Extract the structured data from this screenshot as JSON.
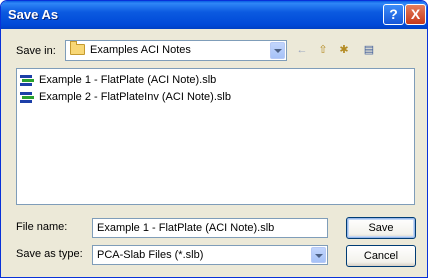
{
  "window": {
    "title": "Save As"
  },
  "title_buttons": {
    "help": "?",
    "close": "X"
  },
  "save_in": {
    "label": "Save in:",
    "value": "Examples ACI Notes"
  },
  "toolbar": {
    "back": "←",
    "up": "⇧",
    "new_folder": "✱",
    "views": "▤"
  },
  "files": [
    {
      "name": "Example 1 - FlatPlate (ACI Note).slb"
    },
    {
      "name": "Example 2 - FlatPlateInv (ACI Note).slb"
    }
  ],
  "file_name": {
    "label": "File name:",
    "value": "Example 1 - FlatPlate (ACI Note).slb"
  },
  "save_as_type": {
    "label": "Save as type:",
    "value": "PCA-Slab Files (*.slb)"
  },
  "buttons": {
    "save": "Save",
    "cancel": "Cancel"
  }
}
